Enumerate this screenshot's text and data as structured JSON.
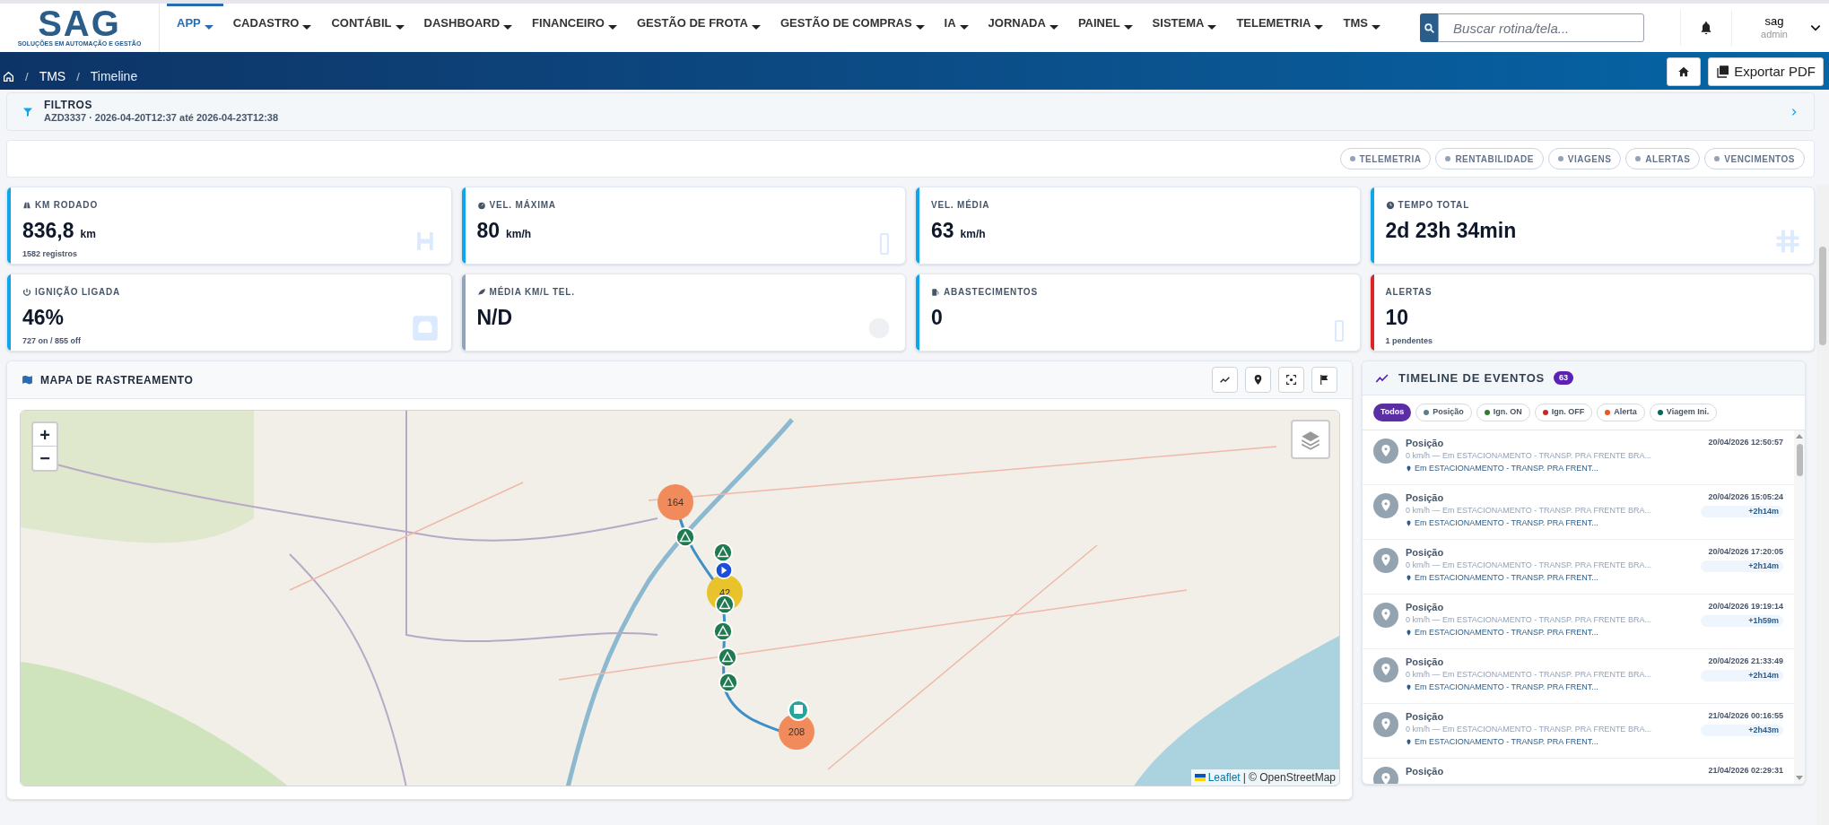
{
  "logo": {
    "text": "SAG",
    "tagline": "SOLUÇÕES EM AUTOMAÇÃO E GESTÃO"
  },
  "nav": [
    {
      "label": "APP",
      "selected": true
    },
    {
      "label": "CADASTRO",
      "selected": false
    },
    {
      "label": "CONTÁBIL",
      "selected": false
    },
    {
      "label": "DASHBOARD",
      "selected": false
    },
    {
      "label": "FINANCEIRO",
      "selected": false
    },
    {
      "label": "GESTÃO DE FROTA",
      "selected": false
    },
    {
      "label": "GESTÃO DE COMPRAS",
      "selected": false
    },
    {
      "label": "IA",
      "selected": false
    },
    {
      "label": "JORNADA",
      "selected": false
    },
    {
      "label": "PAINEL",
      "selected": false
    },
    {
      "label": "SISTEMA",
      "selected": false
    },
    {
      "label": "TELEMETRIA",
      "selected": false
    },
    {
      "label": "TMS",
      "selected": false
    }
  ],
  "search": {
    "placeholder": "Buscar rotina/tela..."
  },
  "user": {
    "name": "sag",
    "role": "admin"
  },
  "breadcrumb": [
    {
      "kind": "separator",
      "text": "/"
    },
    {
      "kind": "link",
      "text": "TMS"
    },
    {
      "kind": "separator",
      "text": "/"
    },
    {
      "kind": "current",
      "text": "Timeline"
    }
  ],
  "export_button": "Exportar PDF",
  "filters": {
    "title": "FILTROS",
    "summary": "AZD3337 · 2026-04-20T12:37 até 2026-04-23T12:38"
  },
  "sections": [
    "TELEMETRIA",
    "RENTABILIDADE",
    "VIAGENS",
    "ALERTAS",
    "VENCIMENTOS"
  ],
  "kpis": [
    {
      "kind": "km",
      "label": "KM RODADO",
      "value": "836,8",
      "unit": "km",
      "note": "1582 registros",
      "color": "#0ea5e9"
    },
    {
      "kind": "speed",
      "label": "VEL. MÁXIMA",
      "value": "80",
      "unit": "km/h",
      "color": "#0ea5e9"
    },
    {
      "kind": "avg",
      "label": "VEL. MÉDIA",
      "value": "63",
      "unit": "km/h",
      "color": "#0ea5e9"
    },
    {
      "kind": "time",
      "label": "TEMPO TOTAL",
      "value": "2d 23h 34min",
      "color": "#0ea5e9"
    },
    {
      "kind": "ignition",
      "label": "IGNIÇÃO LIGADA",
      "value": "46%",
      "note": "727 on / 855 off",
      "color": "#0ea5e9"
    },
    {
      "kind": "fuel_avg",
      "label": "MÉDIA KM/L TEL.",
      "value": "N/D",
      "color": "#94a3b8"
    },
    {
      "kind": "refuel",
      "label": "ABASTECIMENTOS",
      "value": "0",
      "color": "#0ea5e9"
    },
    {
      "kind": "alerts",
      "label": "ALERTAS",
      "value": "10",
      "note": "1 pendentes",
      "color": "#dc2626"
    }
  ],
  "map": {
    "title": "MAPA DE RASTREAMENTO",
    "zoom_in": "+",
    "zoom_out": "−",
    "attribution_link": "Leaflet",
    "attribution": "| © OpenStreetMap",
    "clusters": [
      {
        "count": "164",
        "color": "#f28b5b"
      },
      {
        "count": "42",
        "color": "#e9c32b"
      },
      {
        "count": "208",
        "color": "#f28b5b"
      }
    ]
  },
  "timeline": {
    "title": "TIMELINE DE EVENTOS",
    "count": "63",
    "filters": [
      {
        "label": "Todos",
        "selected": true
      },
      {
        "label": "Posição",
        "selected": false,
        "color": "#607d8b"
      },
      {
        "label": "Ign. ON",
        "selected": false,
        "color": "#2e7d32"
      },
      {
        "label": "Ign. OFF",
        "selected": false,
        "color": "#c62828"
      },
      {
        "label": "Alerta",
        "selected": false,
        "color": "#f4511e"
      },
      {
        "label": "Viagem Ini.",
        "selected": false,
        "color": "#00695c"
      }
    ],
    "events": [
      {
        "title": "Posição",
        "detail": "0 km/h — Em ESTACIONAMENTO - TRANSP. PRA FRENTE BRA...",
        "place": "Em ESTACIONAMENTO - TRANSP. PRA FRENT...",
        "time": "20/04/2026 12:50:57"
      },
      {
        "title": "Posição",
        "detail": "0 km/h — Em ESTACIONAMENTO - TRANSP. PRA FRENTE BRA...",
        "place": "Em ESTACIONAMENTO - TRANSP. PRA FRENT...",
        "time": "20/04/2026 15:05:24",
        "delta": "+2h14m"
      },
      {
        "title": "Posição",
        "detail": "0 km/h — Em ESTACIONAMENTO - TRANSP. PRA FRENTE BRA...",
        "place": "Em ESTACIONAMENTO - TRANSP. PRA FRENT...",
        "time": "20/04/2026 17:20:05",
        "delta": "+2h14m"
      },
      {
        "title": "Posição",
        "detail": "0 km/h — Em ESTACIONAMENTO - TRANSP. PRA FRENTE BRA...",
        "place": "Em ESTACIONAMENTO - TRANSP. PRA FRENT...",
        "time": "20/04/2026 19:19:14",
        "delta": "+1h59m"
      },
      {
        "title": "Posição",
        "detail": "0 km/h — Em ESTACIONAMENTO - TRANSP. PRA FRENTE BRA...",
        "place": "Em ESTACIONAMENTO - TRANSP. PRA FRENT...",
        "time": "20/04/2026 21:33:49",
        "delta": "+2h14m"
      },
      {
        "title": "Posição",
        "detail": "0 km/h — Em ESTACIONAMENTO - TRANSP. PRA FRENTE BRA...",
        "place": "Em ESTACIONAMENTO - TRANSP. PRA FRENT...",
        "time": "21/04/2026 00:16:55",
        "delta": "+2h43m"
      },
      {
        "title": "Posição",
        "time": "21/04/2026 02:29:31"
      }
    ]
  }
}
